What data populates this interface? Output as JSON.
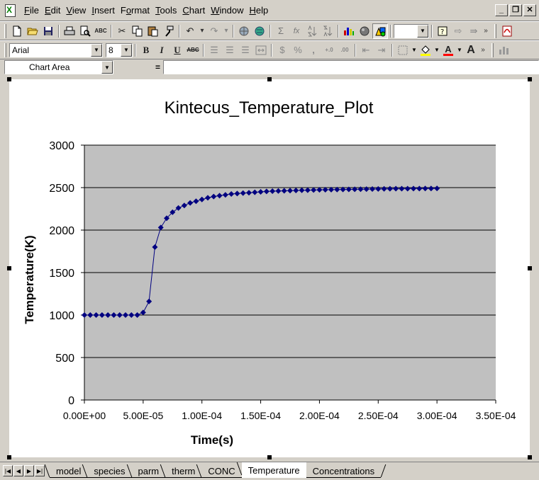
{
  "menu": {
    "items": [
      {
        "label": "File",
        "key": "F",
        "rest": "ile"
      },
      {
        "label": "Edit",
        "key": "E",
        "rest": "dit"
      },
      {
        "label": "View",
        "key": "V",
        "rest": "iew"
      },
      {
        "label": "Insert",
        "key": "I",
        "rest": "nsert"
      },
      {
        "label": "Format",
        "key": "o",
        "pre": "F",
        "rest": "rmat"
      },
      {
        "label": "Tools",
        "key": "T",
        "rest": "ools"
      },
      {
        "label": "Chart",
        "key": "C",
        "rest": "hart"
      },
      {
        "label": "Window",
        "key": "W",
        "rest": "indow"
      },
      {
        "label": "Help",
        "key": "H",
        "rest": "elp"
      }
    ],
    "window_buttons": {
      "minimize": "_",
      "restore": "❐",
      "close": "✕"
    }
  },
  "format_toolbar": {
    "font_name": "Arial",
    "font_size": "8",
    "bold": "B",
    "italic": "I",
    "underline": "U",
    "strike": "ABC",
    "currency": "$",
    "percent": "%",
    "comma": ",",
    "font_color_letter": "A",
    "grow_font": "A"
  },
  "standard_toolbar": {
    "sum": "Σ",
    "fx": "fx",
    "zoom_value": ""
  },
  "name_box": {
    "value": "Chart Area",
    "equals": "="
  },
  "chart_data": {
    "type": "line",
    "title": "Kintecus_Temperature_Plot",
    "xlabel": "Time(s)",
    "ylabel": "Temperature(K)",
    "xlim": [
      0,
      0.00035
    ],
    "ylim": [
      0,
      3000
    ],
    "xticks": [
      0,
      5e-05,
      0.0001,
      0.00015,
      0.0002,
      0.00025,
      0.0003,
      0.00035
    ],
    "xtick_labels": [
      "0.00E+00",
      "5.00E-05",
      "1.00E-04",
      "1.50E-04",
      "2.00E-04",
      "2.50E-04",
      "3.00E-04",
      "3.50E-04"
    ],
    "yticks": [
      0,
      500,
      1000,
      1500,
      2000,
      2500,
      3000
    ],
    "ytick_labels": [
      "0",
      "500",
      "1000",
      "1500",
      "2000",
      "2500",
      "3000"
    ],
    "grid": "horizontal",
    "plot_bg": "#c0c0c0",
    "series_color": "#000080",
    "series": [
      {
        "x": [
          0,
          5e-06,
          1e-05,
          1.5e-05,
          2e-05,
          2.5e-05,
          3e-05,
          3.5e-05,
          4e-05,
          4.5e-05,
          5e-05,
          5.5e-05,
          6e-05,
          6.5e-05,
          7e-05,
          7.5e-05,
          8e-05,
          8.5e-05,
          9e-05,
          9.5e-05,
          0.0001,
          0.000105,
          0.00011,
          0.000115,
          0.00012,
          0.000125,
          0.00013,
          0.000135,
          0.00014,
          0.000145,
          0.00015,
          0.000155,
          0.00016,
          0.000165,
          0.00017,
          0.000175,
          0.00018,
          0.000185,
          0.00019,
          0.000195,
          0.0002,
          0.000205,
          0.00021,
          0.000215,
          0.00022,
          0.000225,
          0.00023,
          0.000235,
          0.00024,
          0.000245,
          0.00025,
          0.000255,
          0.00026,
          0.000265,
          0.00027,
          0.000275,
          0.00028,
          0.000285,
          0.00029,
          0.000295,
          0.0003
        ],
        "y": [
          1000,
          1000,
          1000,
          1000,
          1000,
          1000,
          1000,
          1000,
          1000,
          1000,
          1030,
          1160,
          1800,
          2030,
          2140,
          2210,
          2260,
          2290,
          2320,
          2340,
          2360,
          2380,
          2395,
          2405,
          2415,
          2425,
          2430,
          2435,
          2440,
          2445,
          2450,
          2455,
          2458,
          2460,
          2462,
          2465,
          2467,
          2469,
          2470,
          2472,
          2474,
          2475,
          2476,
          2477,
          2478,
          2479,
          2480,
          2481,
          2482,
          2483,
          2484,
          2485,
          2486,
          2487,
          2487,
          2488,
          2489,
          2489,
          2490,
          2490,
          2491
        ]
      }
    ]
  },
  "sheet_tabs": {
    "tabs": [
      "model",
      "species",
      "parm",
      "therm",
      "CONC",
      "Temperature",
      "Concentrations"
    ],
    "active": "Temperature",
    "nav": [
      "|◀",
      "◀",
      "▶",
      "▶|"
    ]
  }
}
